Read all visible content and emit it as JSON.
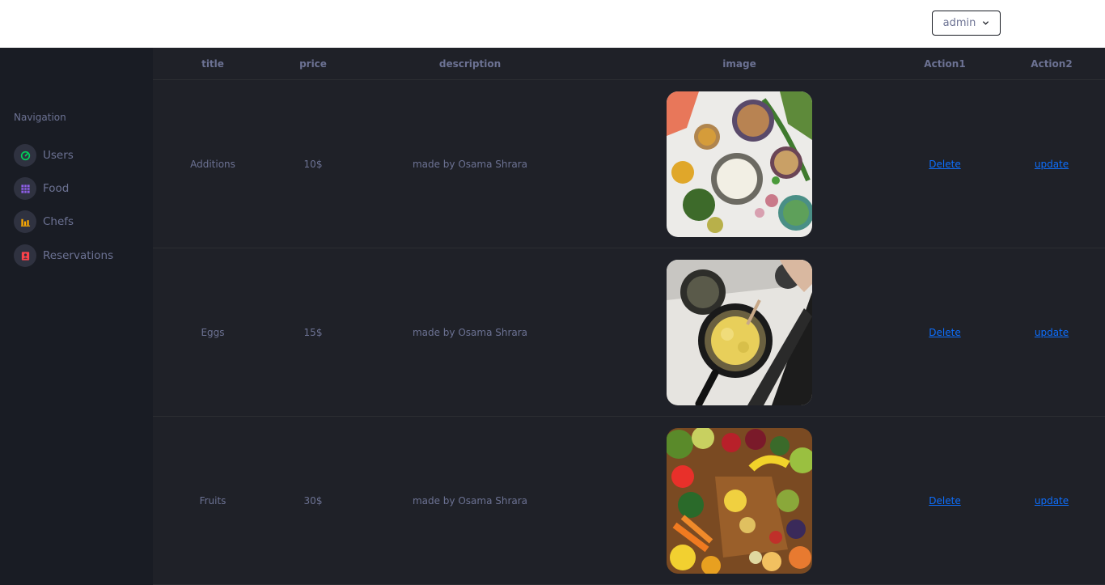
{
  "header": {
    "user_button_label": "admin"
  },
  "sidebar": {
    "heading": "Navigation",
    "items": [
      {
        "label": "Users",
        "icon": "speedometer-icon",
        "color": "#00d25b"
      },
      {
        "label": "Food",
        "icon": "table-grid-icon",
        "color": "#8f5fe8"
      },
      {
        "label": "Chefs",
        "icon": "bar-chart-icon",
        "color": "#ffab00"
      },
      {
        "label": "Reservations",
        "icon": "contact-card-icon",
        "color": "#fc424a"
      }
    ]
  },
  "table": {
    "columns": [
      "title",
      "price",
      "description",
      "image",
      "Action1",
      "Action2"
    ],
    "rows": [
      {
        "title": "Additions",
        "price": "10$",
        "description": "made by Osama Shrara",
        "image": "spices-bowls-photo",
        "action1": "Delete",
        "action2": "update"
      },
      {
        "title": "Eggs",
        "price": "15$",
        "description": "made by Osama Shrara",
        "image": "pan-cooking-photo",
        "action1": "Delete",
        "action2": "update"
      },
      {
        "title": "Fruits",
        "price": "30$",
        "description": "made by Osama Shrara",
        "image": "fruits-vegetables-photo",
        "action1": "Delete",
        "action2": "update"
      }
    ]
  },
  "colors": {
    "sidebar_bg": "#191c24",
    "content_bg": "#1f2128",
    "text_muted": "#6c7293",
    "link": "#0d6efd"
  }
}
